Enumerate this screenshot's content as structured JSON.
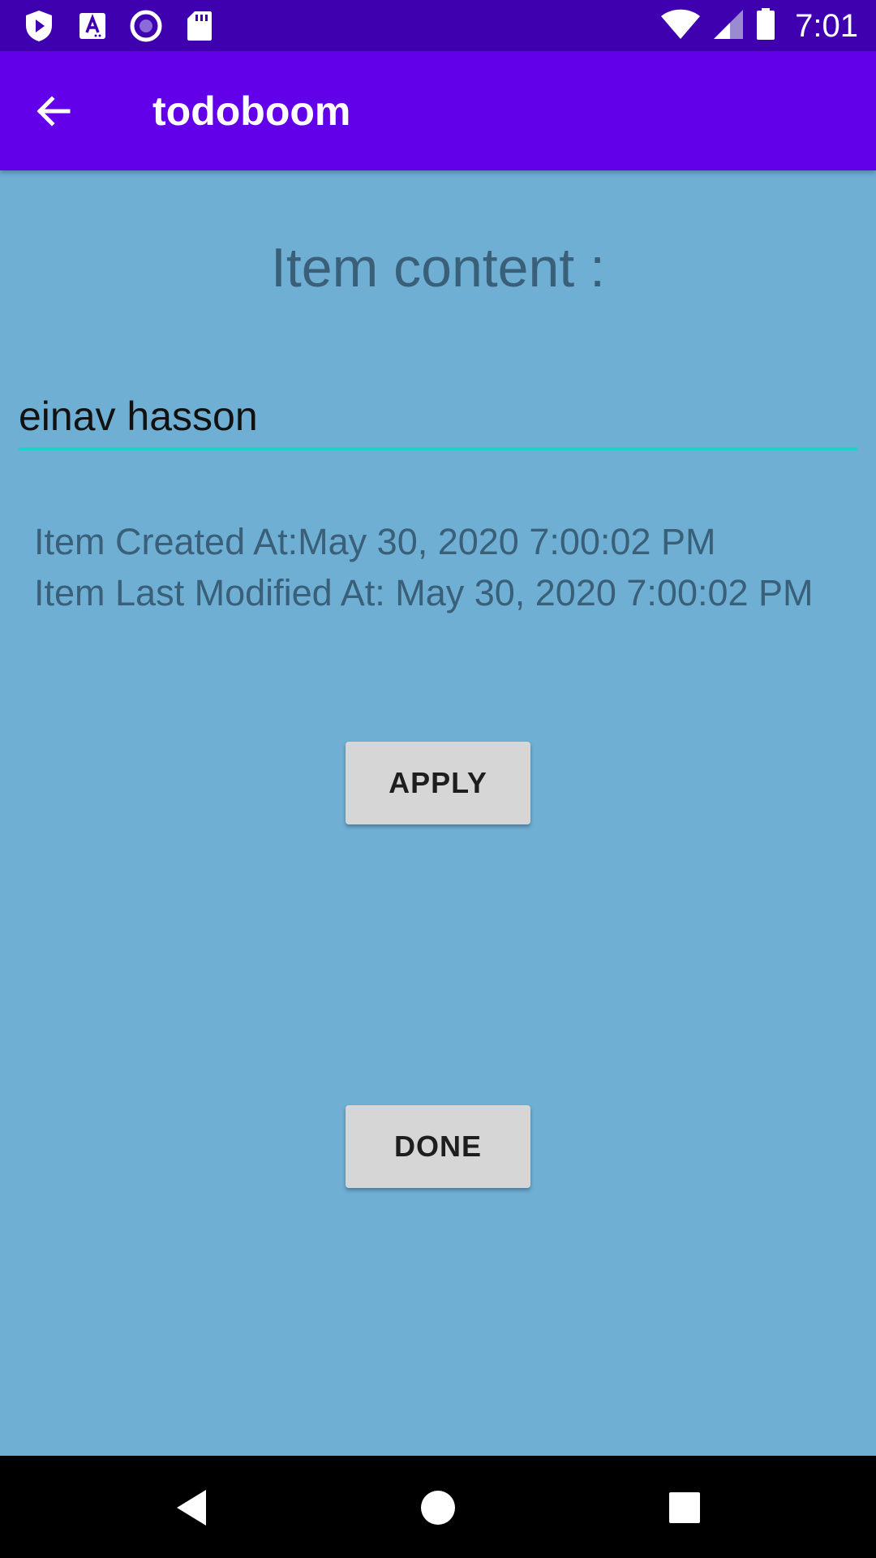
{
  "status_bar": {
    "time": "7:01",
    "left_icons": [
      "shield-play-icon",
      "a11y-a-icon",
      "record-circle-icon",
      "sd-card-icon"
    ],
    "right_icons": [
      "wifi-icon",
      "cell-signal-icon",
      "battery-icon"
    ]
  },
  "app_bar": {
    "title": "todoboom",
    "back_icon": "arrow-back-icon",
    "color": "#6200ea"
  },
  "main": {
    "heading": "Item content :",
    "content_value": "einav hasson",
    "created_text": "Item Created At:May 30, 2020 7:00:02 PM",
    "modified_text": "Item Last Modified At: May 30, 2020 7:00:02 PM",
    "apply_label": "APPLY",
    "done_label": "DONE",
    "background_color": "#6fafd4",
    "underline_color": "#1ed2c8"
  },
  "nav_bar": {
    "icons": [
      "nav-back-icon",
      "nav-home-icon",
      "nav-recents-icon"
    ]
  }
}
